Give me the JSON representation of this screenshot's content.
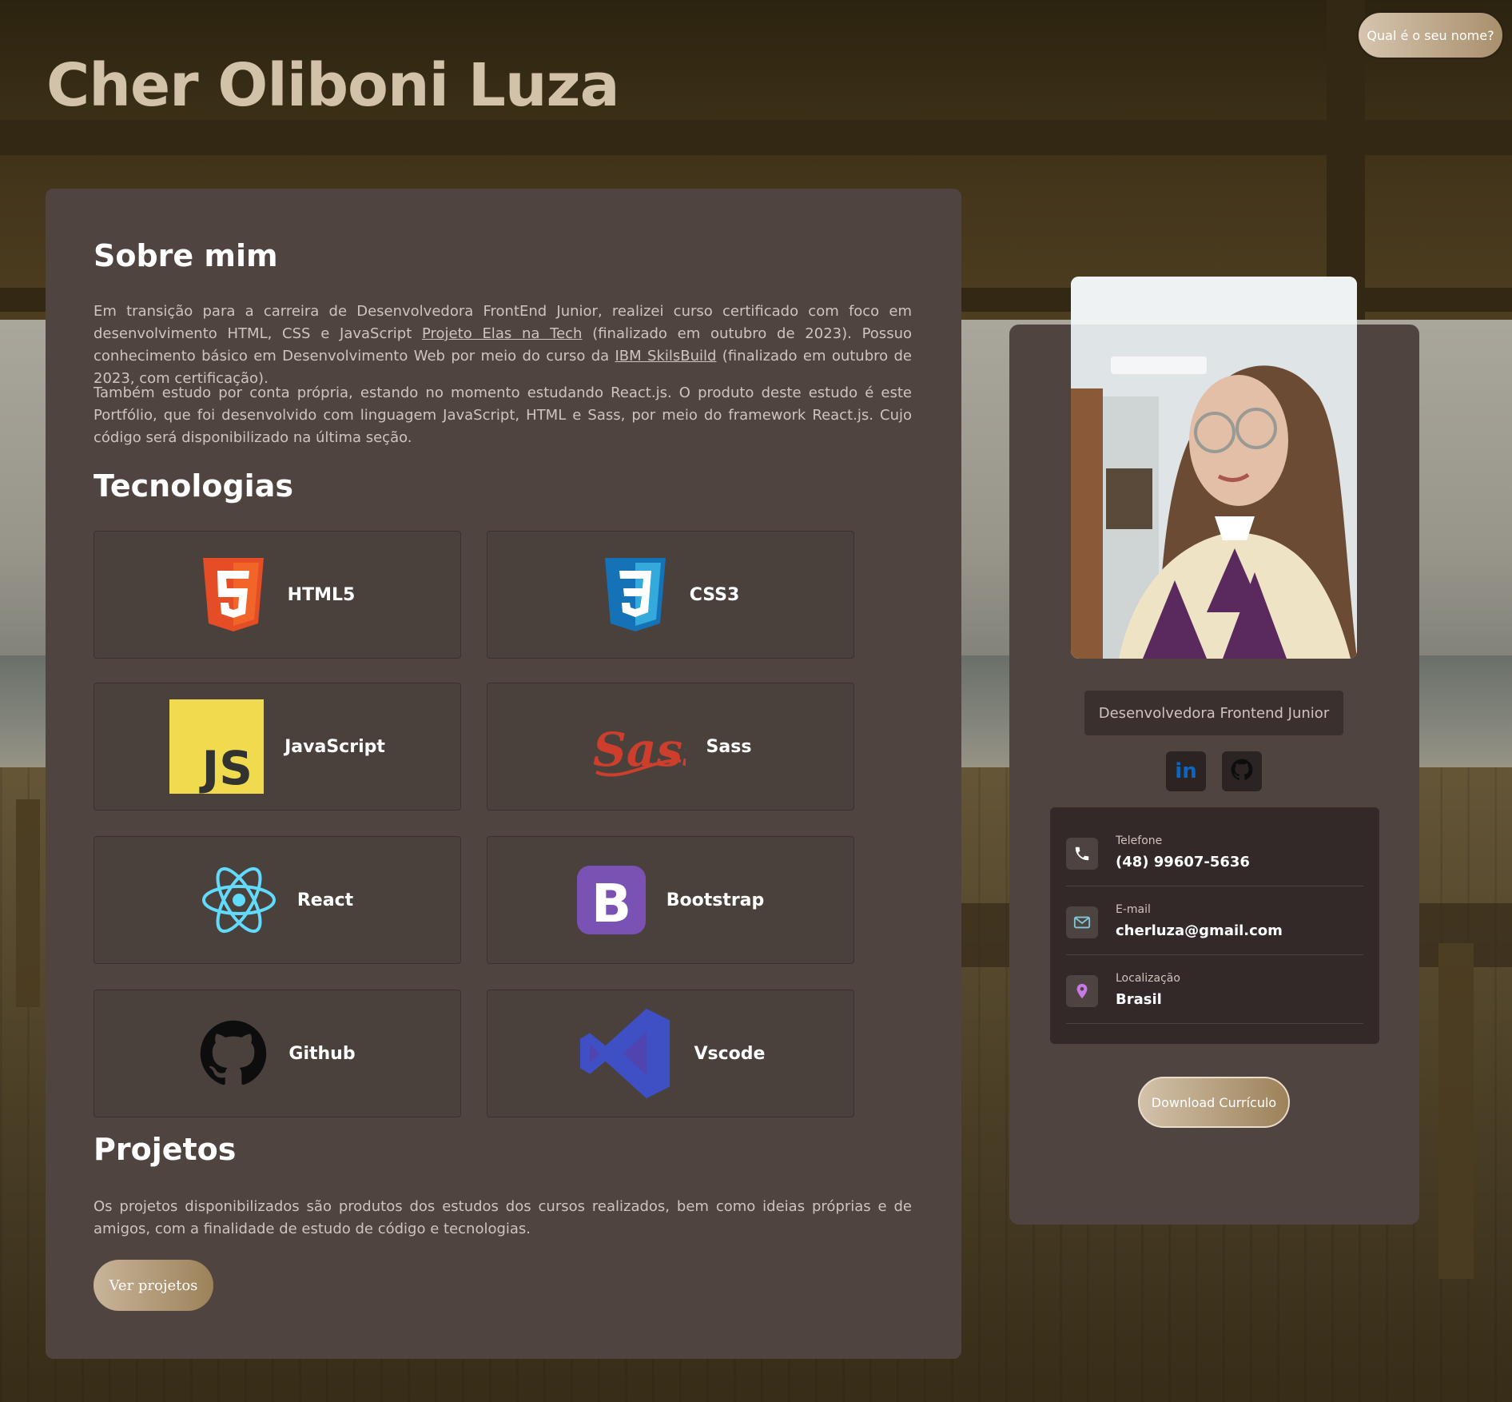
{
  "header": {
    "title": "Cher Oliboni Luza",
    "name_button": "Qual é o seu nome?"
  },
  "about": {
    "heading": "Sobre mim",
    "p1_a": "Em transição para a carreira de Desenvolvedora FrontEnd Junior, realizei curso certificado com foco em desenvolvimento HTML, CSS e JavaScript ",
    "p1_link1": "Projeto Elas na Tech",
    "p1_b": " (finalizado em outubro de 2023). Possuo conhecimento básico em Desenvolvimento Web por meio do curso da ",
    "p1_link2": "IBM SkilsBuild",
    "p1_c": " (finalizado em outubro de 2023, com certificação).",
    "p2": "Também estudo por conta própria, estando no momento estudando React.js. O produto deste estudo é este Portfólio, que foi desenvolvido com linguagem JavaScript, HTML e Sass, por meio do framework React.js. Cujo código será disponibilizado na última seção."
  },
  "technologies": {
    "heading": "Tecnologias",
    "items": [
      {
        "label": "HTML5",
        "icon": "html5-icon",
        "color": "#e44d26"
      },
      {
        "label": "CSS3",
        "icon": "css3-icon",
        "color": "#1572b6"
      },
      {
        "label": "JavaScript",
        "icon": "javascript-icon",
        "color": "#f0db4f"
      },
      {
        "label": "Sass",
        "icon": "sass-icon",
        "color": "#cd3f2c"
      },
      {
        "label": "React",
        "icon": "react-icon",
        "color": "#61dafb"
      },
      {
        "label": "Bootstrap",
        "icon": "bootstrap-icon",
        "color": "#7952b3"
      },
      {
        "label": "Github",
        "icon": "github-icon",
        "color": "#000000"
      },
      {
        "label": "Vscode",
        "icon": "vscode-icon",
        "color": "#3f4fc4"
      }
    ]
  },
  "projects": {
    "heading": "Projetos",
    "text": "Os projetos disponibilizados são produtos dos estudos dos cursos realizados, bem como ideias próprias e de amigos, com a finalidade de estudo de código e tecnologias.",
    "button": "Ver projetos"
  },
  "profile": {
    "role": "Desenvolvedora Frontend Junior",
    "social": [
      {
        "icon": "linkedin-icon",
        "label": "in"
      },
      {
        "icon": "github-icon"
      }
    ],
    "contacts": [
      {
        "label": "Telefone",
        "value": "(48) 99607-5636",
        "icon": "phone-icon"
      },
      {
        "label": "E-mail",
        "value": "cherluza@gmail.com",
        "icon": "mail-icon"
      },
      {
        "label": "Localização",
        "value": "Brasil",
        "icon": "location-icon"
      }
    ],
    "download_button": "Download Currículo"
  }
}
